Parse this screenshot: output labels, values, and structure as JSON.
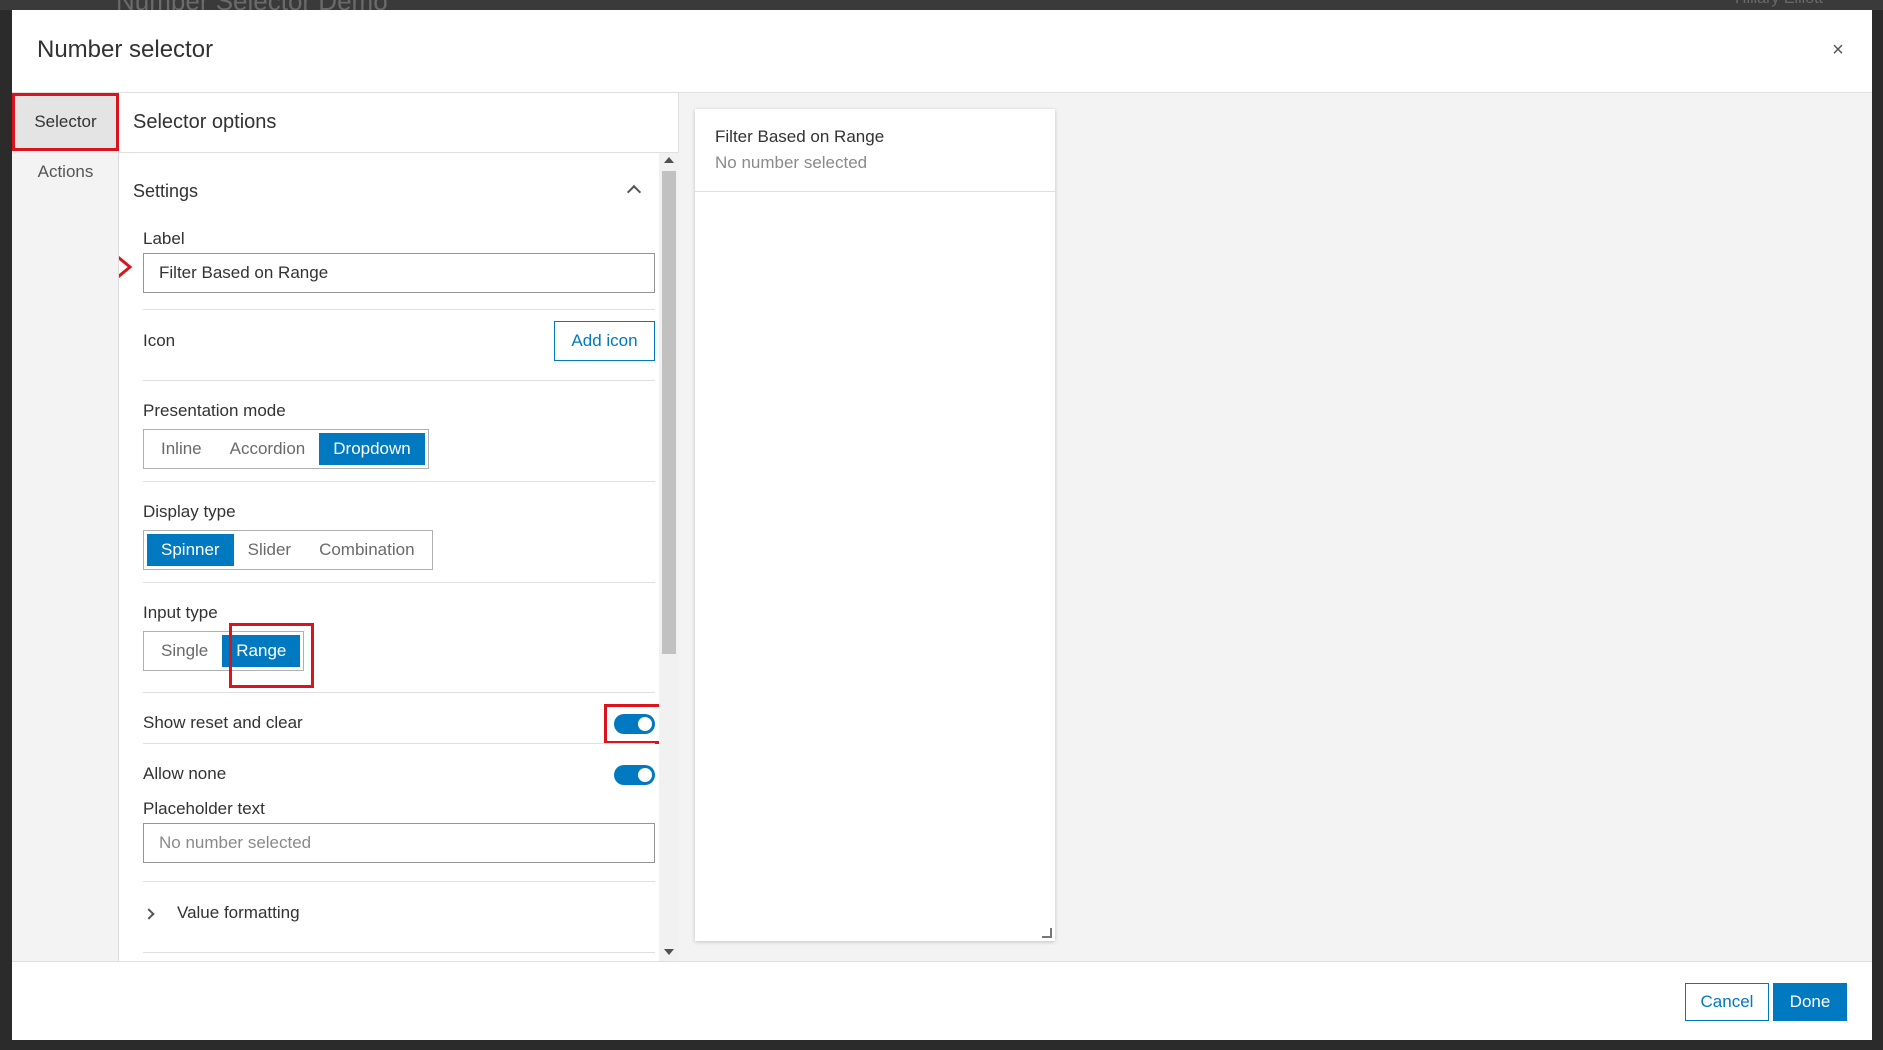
{
  "background": {
    "title": "Number Selector Demo",
    "user": "Hillary Elliott"
  },
  "modal": {
    "title": "Number selector",
    "close_icon": "close-icon",
    "close_glyph": "×"
  },
  "nav": {
    "items": [
      {
        "label": "Selector",
        "active": true
      },
      {
        "label": "Actions",
        "active": false
      }
    ]
  },
  "options": {
    "title": "Selector options",
    "settings": {
      "section_label": "Settings",
      "label_field": {
        "label": "Label",
        "value": "Filter Based on Range"
      },
      "icon_field": {
        "label": "Icon",
        "button": "Add icon"
      },
      "presentation_mode": {
        "label": "Presentation mode",
        "options": [
          "Inline",
          "Accordion",
          "Dropdown"
        ],
        "selected": "Dropdown"
      },
      "display_type": {
        "label": "Display type",
        "options": [
          "Spinner",
          "Slider",
          "Combination"
        ],
        "selected": "Spinner"
      },
      "input_type": {
        "label": "Input type",
        "options": [
          "Single",
          "Range"
        ],
        "selected": "Range"
      },
      "show_reset_clear": {
        "label": "Show reset and clear",
        "on": true
      },
      "allow_none": {
        "label": "Allow none",
        "on": true
      },
      "placeholder": {
        "label": "Placeholder text",
        "value": "No number selected"
      },
      "value_formatting": {
        "label": "Value formatting"
      }
    }
  },
  "preview": {
    "title": "Filter Based on Range",
    "subtitle": "No number selected"
  },
  "footer": {
    "cancel_label": "Cancel",
    "done_label": "Done"
  },
  "colors": {
    "accent": "#0079c1",
    "highlight": "#d9141d"
  }
}
